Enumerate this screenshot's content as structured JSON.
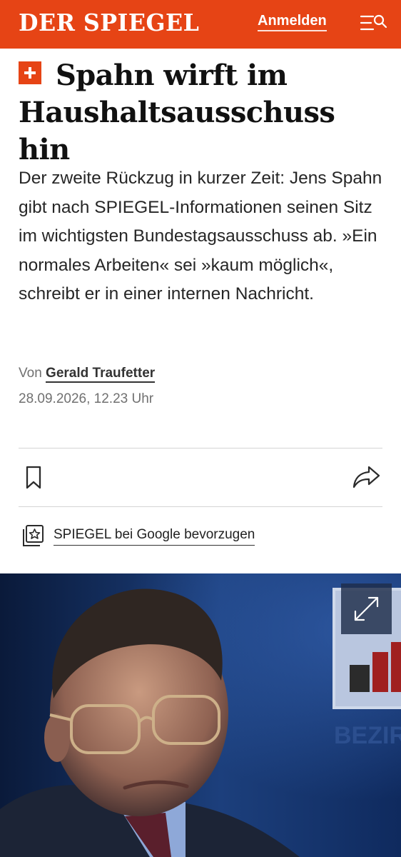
{
  "header": {
    "logo": "DER SPIEGEL",
    "login_label": "Anmelden",
    "menu_icon": "menu-search-icon",
    "bar_color": "#e64415"
  },
  "article": {
    "plus_icon": "spiegel-plus-icon",
    "headline": "Spahn wirft im Haushaltsausschuss hin",
    "teaser": "Der zweite Rückzug in kurzer Zeit: Jens Spahn gibt nach SPIEGEL-Informationen seinen Sitz im wichtigsten Bundestagsausschuss ab. »Ein normales Arbeiten« sei »kaum möglich«, schreibt er in einer internen Nachricht.",
    "author_prefix": "Von",
    "author_name": "Gerald Traufetter",
    "date": "28.09.2026, 12.23 Uhr"
  },
  "actions": {
    "bookmark_icon": "bookmark-icon",
    "share_icon": "share-icon",
    "google_icon": "google-preferred-source-icon",
    "google_label": "SPIEGEL bei Google bevorzugen"
  },
  "hero_image": {
    "expand_icon": "expand-icon",
    "background_text": "BEZIR"
  }
}
